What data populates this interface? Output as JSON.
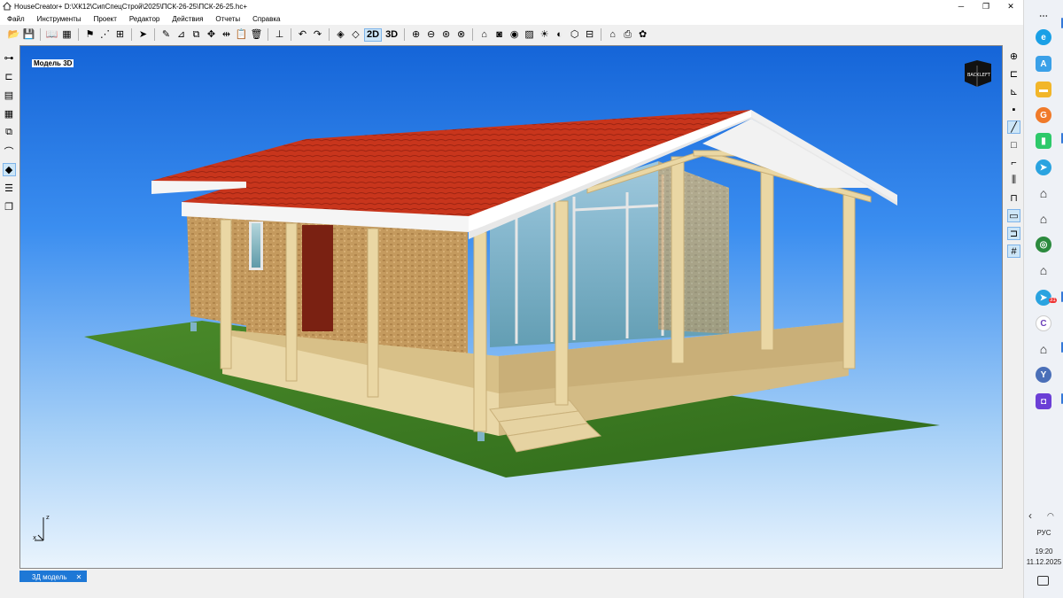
{
  "window": {
    "title": "HouseCreator+ D:\\ХК12\\СипСпецСтрой\\2025\\ПСК-26-25\\ПСК-26-25.hc+"
  },
  "menu": [
    "Файл",
    "Инструменты",
    "Проект",
    "Редактор",
    "Действия",
    "Отчеты",
    "Справка"
  ],
  "toolbar": {
    "mode_2d": "2D",
    "mode_3d": "3D"
  },
  "viewport": {
    "label": "Модель 3D",
    "cube_left": "BACK",
    "cube_right": "LEFT",
    "axis_z": "z",
    "axis_x": "x"
  },
  "tabs": [
    {
      "label": "3Д модель",
      "close": "✕"
    }
  ],
  "taskbar": {
    "lang": "РУС",
    "time": "19:20",
    "date": "11.12.2025",
    "badge": "31"
  },
  "colors": {
    "accent": "#1e78d6",
    "roof": "#c8351c",
    "sky_top": "#1565d8",
    "grass": "#3e7a22"
  }
}
